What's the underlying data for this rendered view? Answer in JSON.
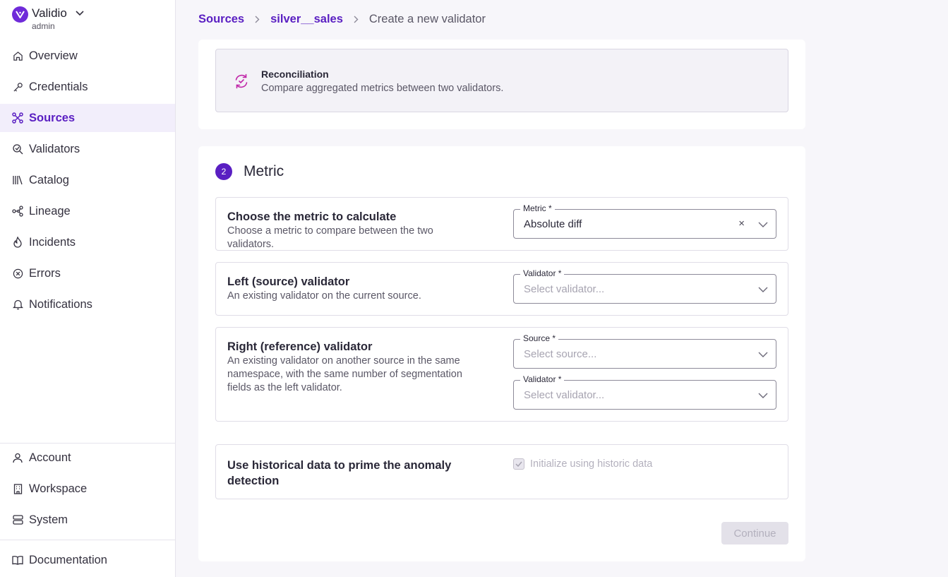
{
  "brand": {
    "name": "Validio",
    "role": "admin"
  },
  "nav": {
    "top": [
      {
        "label": "Overview",
        "icon": "home-icon"
      },
      {
        "label": "Credentials",
        "icon": "key-icon"
      },
      {
        "label": "Sources",
        "icon": "sources-icon",
        "active": true
      },
      {
        "label": "Validators",
        "icon": "validators-icon"
      },
      {
        "label": "Catalog",
        "icon": "catalog-icon"
      },
      {
        "label": "Lineage",
        "icon": "lineage-icon"
      },
      {
        "label": "Incidents",
        "icon": "flame-icon"
      },
      {
        "label": "Errors",
        "icon": "error-icon"
      },
      {
        "label": "Notifications",
        "icon": "bell-icon"
      }
    ],
    "bottom": [
      {
        "label": "Account",
        "icon": "user-icon"
      },
      {
        "label": "Workspace",
        "icon": "building-icon"
      },
      {
        "label": "System",
        "icon": "server-icon"
      }
    ],
    "documentation": {
      "label": "Documentation",
      "icon": "book-icon"
    }
  },
  "breadcrumb": {
    "items": [
      "Sources",
      "silver__sales"
    ],
    "current": "Create a new validator"
  },
  "reconciliation": {
    "title": "Reconciliation",
    "description": "Compare aggregated metrics between two validators."
  },
  "metric_section": {
    "step": "2",
    "title": "Metric",
    "metric_row": {
      "title": "Choose the metric to calculate",
      "description": "Choose a metric to compare between the two validators.",
      "field_label": "Metric *",
      "field_value": "Absolute diff",
      "clear": "×"
    },
    "left_row": {
      "title": "Left (source) validator",
      "description": "An existing validator on the current source.",
      "field_label": "Validator *",
      "placeholder": "Select validator..."
    },
    "right_row": {
      "title": "Right (reference) validator",
      "description": "An existing validator on another source in the same namespace, with the same number of segmentation fields as the left validator.",
      "source_label": "Source *",
      "source_placeholder": "Select source...",
      "validator_label": "Validator *",
      "validator_placeholder": "Select validator..."
    },
    "history_row": {
      "title": "Use historical data to prime the anomaly detection",
      "checkbox_label": "Initialize using historic data",
      "checked": true,
      "disabled": true
    },
    "continue_label": "Continue"
  },
  "colors": {
    "accent": "#5a1fc2",
    "brand": "#6f2bd9",
    "recon_icon": "#c026a8"
  }
}
